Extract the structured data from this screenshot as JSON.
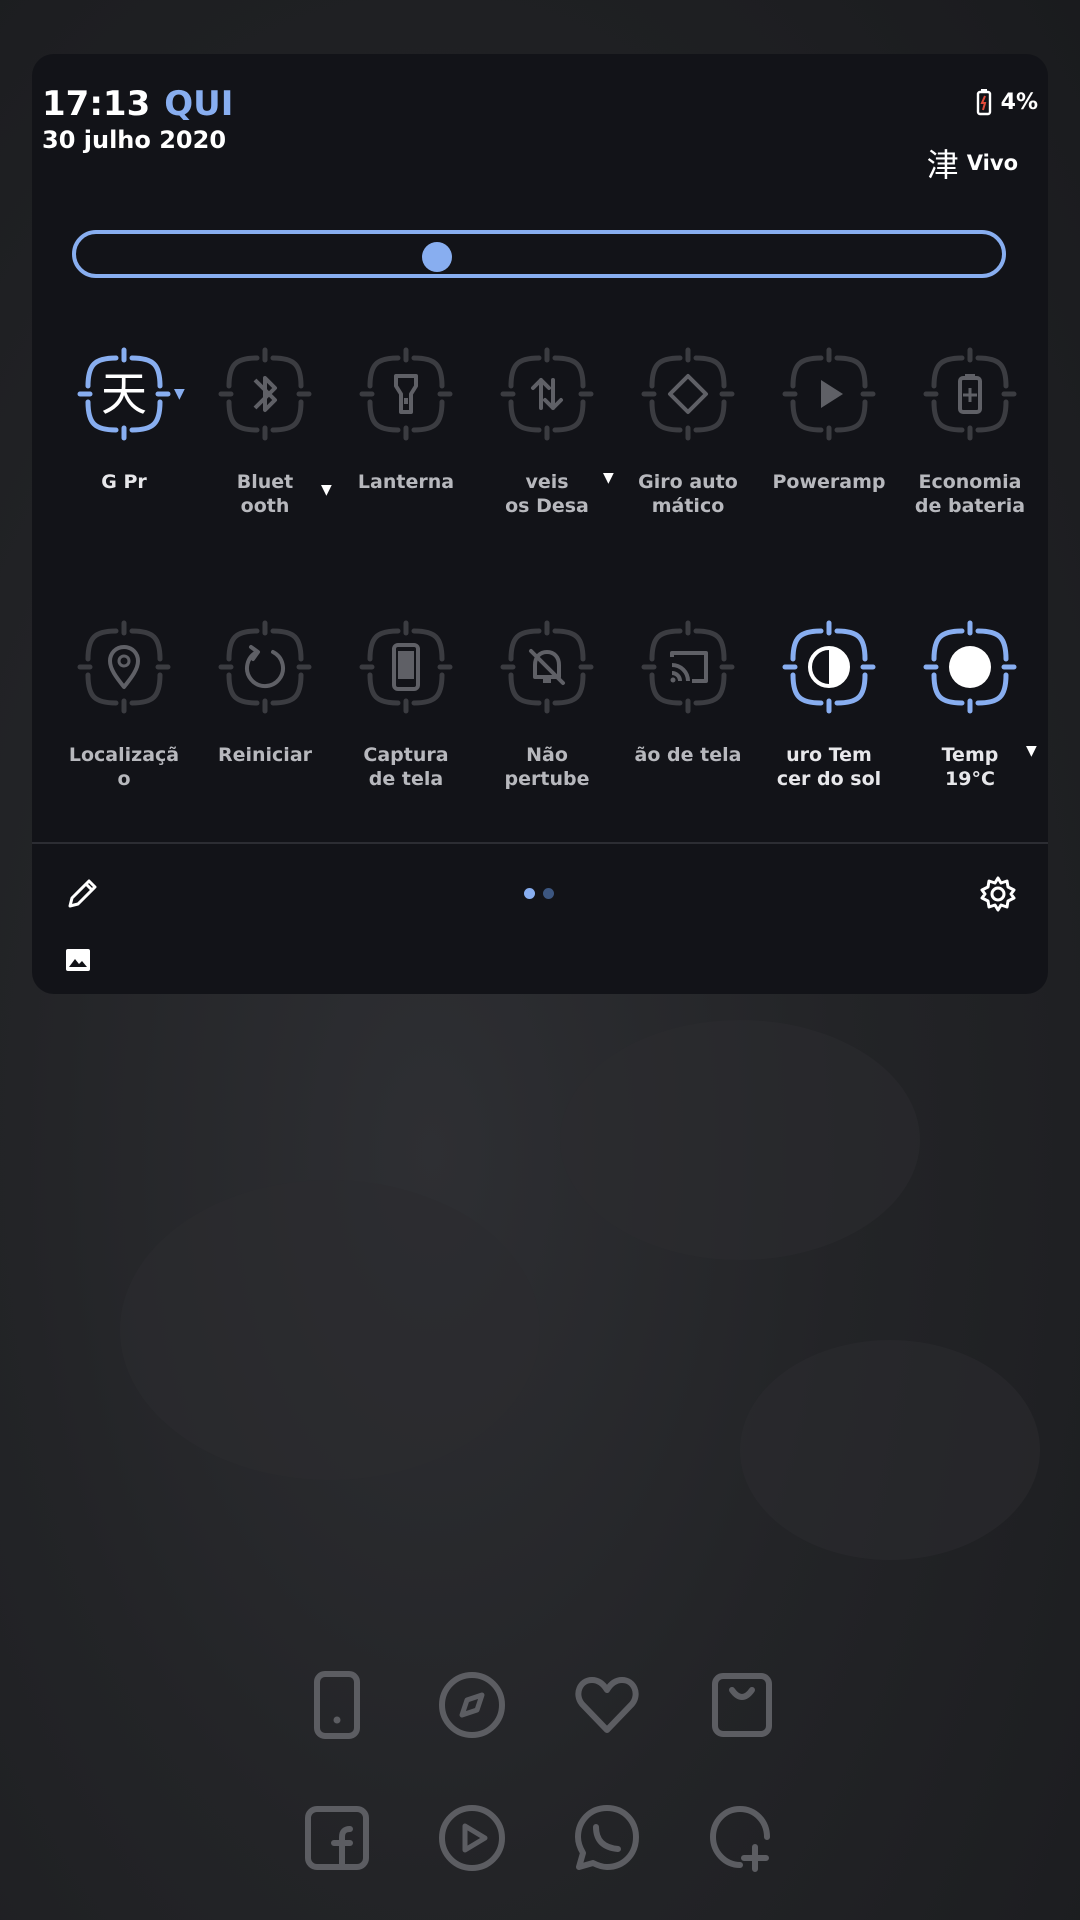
{
  "status": {
    "time": "17:13",
    "day": "QUI",
    "date": "30 julho 2020",
    "battery": "4%",
    "carrier_glyph": "津",
    "carrier": "Vivo"
  },
  "brightness": {
    "level": 0.39
  },
  "tiles_row1": [
    {
      "icon": "sky-glyph-icon",
      "glyph": "天",
      "label": "G   Pr",
      "active": true,
      "caret": true
    },
    {
      "icon": "bluetooth-icon",
      "label": "Bluet\nooth",
      "active": false,
      "caret": true
    },
    {
      "icon": "flashlight-icon",
      "label": "Lanterna",
      "active": false,
      "caret": false
    },
    {
      "icon": "data-transfer-icon",
      "label": "veis\nos    Desa",
      "active": false,
      "caret": true
    },
    {
      "icon": "auto-rotate-icon",
      "label": "Giro auto\nmático",
      "active": false,
      "caret": false
    },
    {
      "icon": "play-icon",
      "label": "Poweramp",
      "active": false,
      "caret": false
    },
    {
      "icon": "battery-saver-icon",
      "label": "Economia\nde bateria",
      "active": false,
      "caret": false
    }
  ],
  "tiles_row2": [
    {
      "icon": "location-pin-icon",
      "label": "Localizaçã\no",
      "active": false,
      "caret": false
    },
    {
      "icon": "restart-icon",
      "label": "Reiniciar",
      "active": false,
      "caret": false
    },
    {
      "icon": "phone-screenshot-icon",
      "label": "Captura\nde tela",
      "active": false,
      "caret": false
    },
    {
      "icon": "bell-off-icon",
      "label": "Não\npertube",
      "active": false,
      "caret": false
    },
    {
      "icon": "cast-icon",
      "label": "ão de tela",
      "active": false,
      "caret": false
    },
    {
      "icon": "contrast-icon",
      "label": "uro   Tem\ncer do sol",
      "active": true,
      "caret": false
    },
    {
      "icon": "circle-icon",
      "label": "Temp\n19°C",
      "active": true,
      "caret": true
    }
  ],
  "page_indicator": {
    "current": 1,
    "total": 2
  },
  "dock": {
    "row1": [
      "phone-icon",
      "compass-icon",
      "heart-icon",
      "shopping-bag-icon"
    ],
    "row2": [
      "facebook-icon",
      "play-circle-icon",
      "whatsapp-icon",
      "add-chat-icon"
    ]
  },
  "colors": {
    "accent": "#88aef0",
    "panel": "#121318",
    "tile_inactive": "#3b3c41"
  }
}
